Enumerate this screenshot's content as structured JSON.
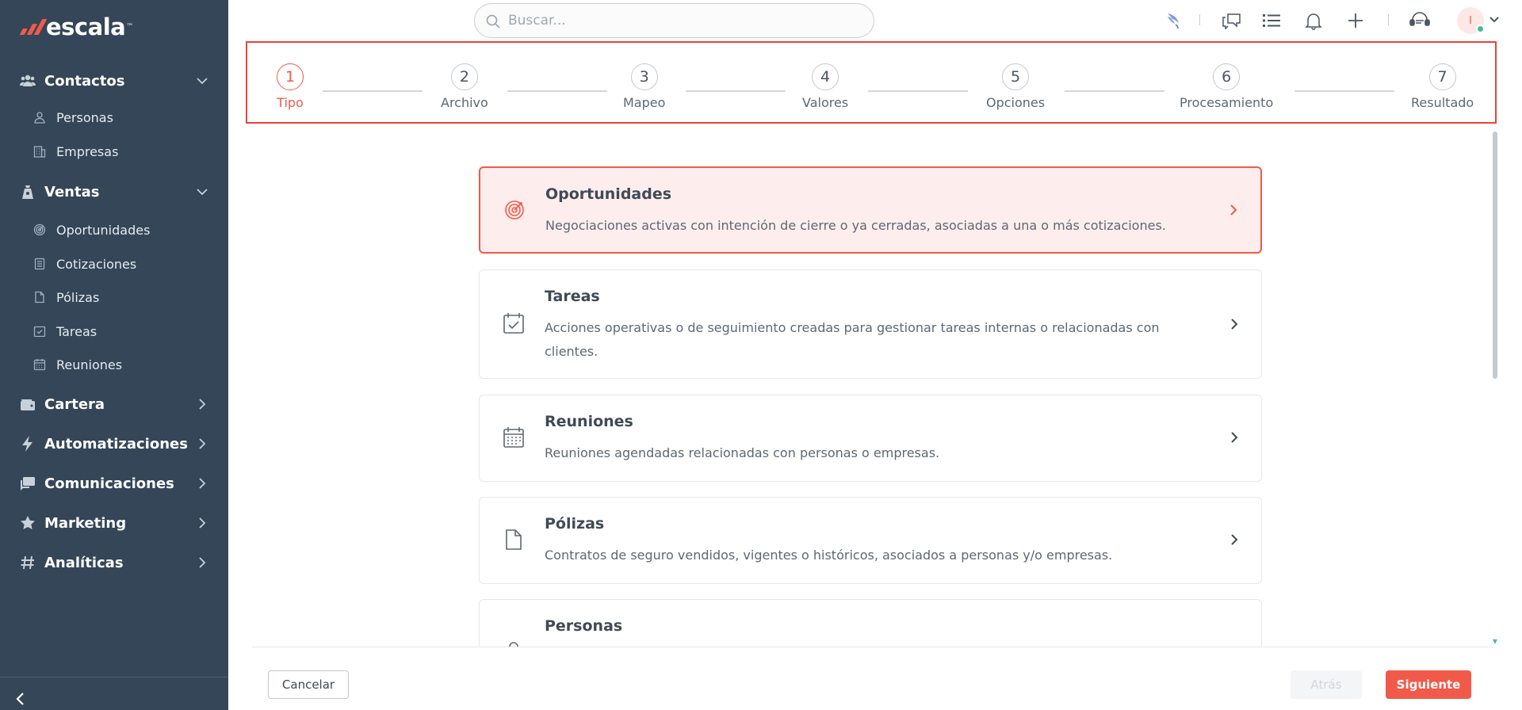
{
  "brand": {
    "name": "escala",
    "trademark": "™",
    "accent_color": "#f15a4a",
    "sidebar_color": "#344657"
  },
  "sidebar": {
    "sections": [
      {
        "label": "Contactos",
        "icon": "users-icon",
        "expanded": true,
        "items": [
          {
            "label": "Personas",
            "icon": "person-icon"
          },
          {
            "label": "Empresas",
            "icon": "building-icon"
          }
        ]
      },
      {
        "label": "Ventas",
        "icon": "sales-icon",
        "expanded": true,
        "items": [
          {
            "label": "Oportunidades",
            "icon": "target-icon"
          },
          {
            "label": "Cotizaciones",
            "icon": "document-list-icon"
          },
          {
            "label": "Pólizas",
            "icon": "file-icon"
          },
          {
            "label": "Tareas",
            "icon": "task-check-icon"
          },
          {
            "label": "Reuniones",
            "icon": "calendar-icon"
          }
        ]
      },
      {
        "label": "Cartera",
        "icon": "wallet-icon",
        "expanded": false
      },
      {
        "label": "Automatizaciones",
        "icon": "bolt-icon",
        "expanded": false
      },
      {
        "label": "Comunicaciones",
        "icon": "chat-icon",
        "expanded": false
      },
      {
        "label": "Marketing",
        "icon": "star-icon",
        "expanded": false
      },
      {
        "label": "Analíticas",
        "icon": "hash-icon",
        "expanded": false
      }
    ]
  },
  "header": {
    "search_placeholder": "Buscar...",
    "avatar_initial": "I",
    "icons": [
      "bird-icon",
      "messages-icon",
      "list-icon",
      "bell-icon",
      "plus-icon",
      "support-icon"
    ]
  },
  "stepper": {
    "current_step": 1,
    "steps": [
      {
        "number": "1",
        "label": "Tipo"
      },
      {
        "number": "2",
        "label": "Archivo"
      },
      {
        "number": "3",
        "label": "Mapeo"
      },
      {
        "number": "4",
        "label": "Valores"
      },
      {
        "number": "5",
        "label": "Opciones"
      },
      {
        "number": "6",
        "label": "Procesamiento"
      },
      {
        "number": "7",
        "label": "Resultado"
      }
    ]
  },
  "options": [
    {
      "title": "Oportunidades",
      "description": "Negociaciones activas con intención de cierre o ya cerradas, asociadas a una o más cotizaciones.",
      "icon": "target-icon",
      "selected": true
    },
    {
      "title": "Tareas",
      "description": "Acciones operativas o de seguimiento creadas para gestionar tareas internas o relacionadas con clientes.",
      "icon": "task-check-icon",
      "selected": false
    },
    {
      "title": "Reuniones",
      "description": "Reuniones agendadas relacionadas con personas o empresas.",
      "icon": "calendar-icon",
      "selected": false
    },
    {
      "title": "Pólizas",
      "description": "Contratos de seguro vendidos, vigentes o históricos, asociados a personas y/o empresas.",
      "icon": "file-icon",
      "selected": false
    },
    {
      "title": "Personas",
      "description": "",
      "icon": "person-icon",
      "selected": false
    }
  ],
  "footer": {
    "cancel_label": "Cancelar",
    "back_label": "Atrás",
    "next_label": "Siguiente"
  }
}
